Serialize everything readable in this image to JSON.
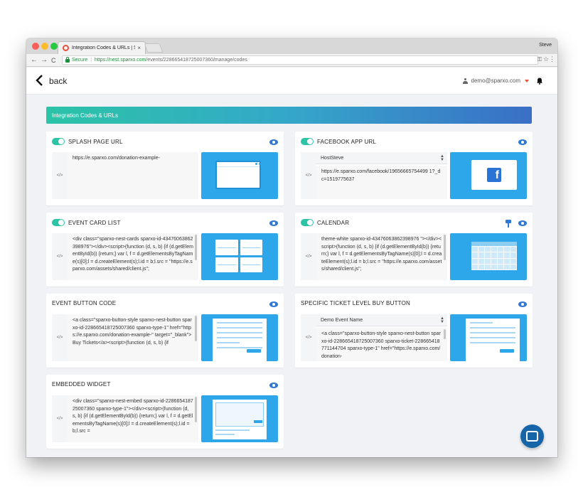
{
  "browser": {
    "tab_title": "Integration Codes & URLs | Sp",
    "tab_close": "×",
    "profile_name": "Steve",
    "secure_label": "Secure",
    "url_host": "https://nest.sparxo.com",
    "url_path": "/events/228665418725007360/manage/codes",
    "back_glyph": "←",
    "forward_glyph": "→",
    "reload_glyph": "C",
    "key_glyph": "⚿",
    "star_glyph": "☆",
    "menu_glyph": "⋮"
  },
  "header": {
    "back_label": "back",
    "account_email": "demo@sparxo.com"
  },
  "banner": {
    "title": "Integration Codes & URLs"
  },
  "code_glyph": "</>",
  "cards": {
    "splash": {
      "title": "SPLASH PAGE URL",
      "enabled": true,
      "code": "https://e.sparxo.com/donation-example-"
    },
    "facebook": {
      "title": "FACEBOOK APP URL",
      "enabled": true,
      "select_value": "HostSteve",
      "code": "https://e.sparxo.com/facebook/19656665754499 1?_dc=1519775637",
      "fb_letter": "f"
    },
    "cardlist": {
      "title": "EVENT CARD LIST",
      "enabled": true,
      "code": "<div class=\"sparxo-nest-cards sparxo-id-434760638623989​76\"></div><script>(function (d, s, b) {if (d.getElementById(b)) {return;} var l, f = d.getElementsByTagName(s)[0];l = d.createElement(s);l.id = b;l.src = \"https://e.sparxo.com/assets/shared/client.js\";"
    },
    "calendar": {
      "title": "CALENDAR",
      "enabled": true,
      "code": "theme-white sparxo-id-434760638623989​76 \"></div><script>(function (d, s, b) {if (d.getElementById(b)) {return;} var l, f = d.getElementsByTagName(s)[0];l = d.createElement(s);l.id = b;l.src = \"https://e.sparxo.com/assets/shared/client.js\";"
    },
    "button": {
      "title": "EVENT BUTTON CODE",
      "code": "<a class=\"sparxo-button-style sparxo-nest-button sparxo-id-228665418725007360 sparxo-type-1\" href=\"https://e.sparxo.com/donation-example-\" target=\"_blank\">Buy Tickets</a><script>(function (d, s, b) {if"
    },
    "ticket": {
      "title": "SPECIFIC TICKET LEVEL BUY BUTTON",
      "select_value": "Demo Event Name",
      "code": "<a class=\"sparxo-button-style sparxo-nest-button sparxo-id-228665418725007360 sparxo-ticket-228665418771144704 sparxo-type-1\" href=\"https://e.sparxo.com/donation-"
    },
    "embed": {
      "title": "EMBEDDED WIDGET",
      "code": "<div class=\"sparxo-nest-embed sparxo-id-228665418725007360 sparxo-type-1\"></div><script>(function (d, s, b) {if (d.getElementById(b)) {return;} var l, f = d.getElementsByTagName(s)[0];l = d.createElement(s);l.id = b;l.src ="
    }
  },
  "colors": {
    "accent_teal": "#2bc4a7",
    "accent_blue": "#2f78d6",
    "preview_blue": "#2ea7ea",
    "chat_blue": "#1565a8"
  }
}
